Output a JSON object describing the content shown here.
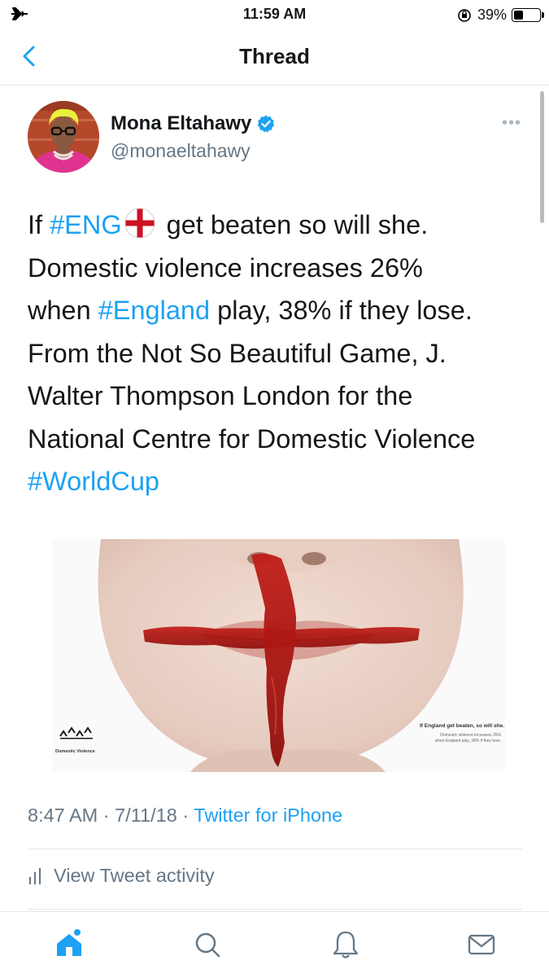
{
  "status_bar": {
    "time": "11:59 AM",
    "battery": "39%",
    "battery_level": 0.39
  },
  "nav": {
    "title": "Thread"
  },
  "tweet": {
    "author_name": "Mona Eltahawy",
    "handle": "@monaeltahawy",
    "text_lines": [
      {
        "pre": "If ",
        "tag": "#ENG",
        "post": " get beaten so will she."
      },
      "Domestic violence increases 26%",
      {
        "pre": "when ",
        "tag": "#England",
        "post": " play, 38% if they lose."
      },
      "From the Not So Beautiful Game, J.",
      "Walter Thompson London for the",
      "National Centre for Domestic Violence",
      {
        "tag": "#WorldCup"
      }
    ],
    "media": {
      "caption_title": "If England get beaten, so will she.",
      "caption_lines": [
        "Domestic violence increases 26%",
        "when England play, 38% if they lose."
      ],
      "logo_text": "Domestic Violence"
    },
    "time": "8:47 AM",
    "date": "7/11/18",
    "source": "Twitter for iPhone",
    "activity_label": "View Tweet activity"
  },
  "tabbar": {
    "items": [
      {
        "icon": "home-icon",
        "active": true,
        "notification_dot": true
      },
      {
        "icon": "search-icon"
      },
      {
        "icon": "bell-icon"
      },
      {
        "icon": "mail-icon"
      }
    ]
  },
  "colors": {
    "accent": "#1da1f2",
    "muted": "#657786",
    "text": "#14171a",
    "blood": "#b81a14"
  }
}
